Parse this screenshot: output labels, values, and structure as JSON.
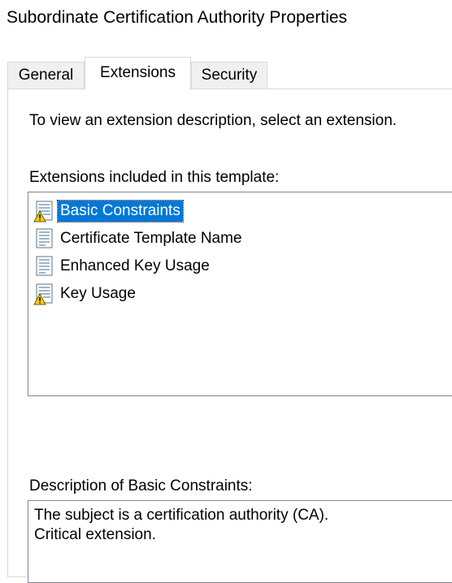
{
  "window": {
    "title": "Subordinate Certification Authority Properties"
  },
  "tabs": [
    {
      "label": "General",
      "active": false
    },
    {
      "label": "Extensions",
      "active": true
    },
    {
      "label": "Security",
      "active": false
    }
  ],
  "extensions_tab": {
    "instruction": "To view an extension description, select an extension.",
    "list_label": "Extensions included in this template:",
    "items": [
      {
        "label": "Basic Constraints",
        "icon": "extension-warning-icon",
        "selected": true
      },
      {
        "label": "Certificate Template Name",
        "icon": "extension-icon",
        "selected": false
      },
      {
        "label": "Enhanced Key Usage",
        "icon": "extension-icon",
        "selected": false
      },
      {
        "label": "Key Usage",
        "icon": "extension-warning-icon",
        "selected": false
      }
    ],
    "description_label": "Description of Basic Constraints:",
    "description_lines": [
      "The subject is a certification authority (CA).",
      "Critical extension."
    ]
  },
  "colors": {
    "selection": "#0078d7",
    "warning": "#f5d000"
  }
}
